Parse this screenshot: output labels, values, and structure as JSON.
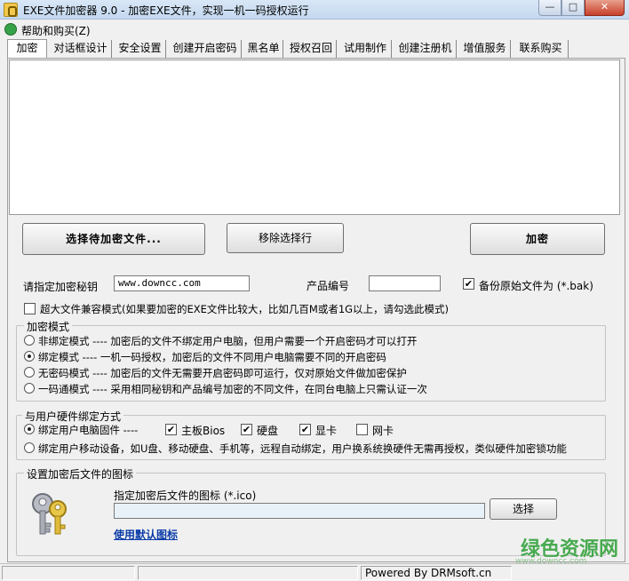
{
  "window": {
    "title": "EXE文件加密器 9.0 - 加密EXE文件，实现一机一码授权运行",
    "controls": {
      "minimize": "—",
      "maximize": "□",
      "close": "✕"
    }
  },
  "menu": {
    "help": "帮助和购买(Z)"
  },
  "tabs": [
    {
      "label": "加密"
    },
    {
      "label": "对话框设计"
    },
    {
      "label": "安全设置"
    },
    {
      "label": "创建开启密码"
    },
    {
      "label": "黑名单"
    },
    {
      "label": "授权召回"
    },
    {
      "label": "试用制作"
    },
    {
      "label": "创建注册机"
    },
    {
      "label": "增值服务"
    },
    {
      "label": "联系购买"
    }
  ],
  "actions": {
    "select_file": "选择待加密文件...",
    "remove_selected": "移除选择行",
    "encrypt": "加密"
  },
  "key_row": {
    "secret_label": "请指定加密秘钥",
    "secret_value": "www.downcc.com",
    "product_label": "产品编号",
    "product_value": "",
    "backup_label": "备份原始文件为 (*.bak)",
    "backup_checked": true
  },
  "large_file": {
    "label": "超大文件兼容模式(如果要加密的EXE文件比较大，比如几百M或者1G以上，请勾选此模式)",
    "checked": false
  },
  "encrypt_mode": {
    "title": "加密模式",
    "options": [
      {
        "label": "非绑定模式 ---- 加密后的文件不绑定用户电脑，但用户需要一个开启密码才可以打开",
        "selected": false
      },
      {
        "label": "绑定模式 ---- 一机一码授权，加密后的文件不同用户电脑需要不同的开启密码",
        "selected": true
      },
      {
        "label": "无密码模式 ---- 加密后的文件无需要开启密码即可运行，仅对原始文件做加密保护",
        "selected": false
      },
      {
        "label": "一码通模式 ---- 采用相同秘钥和产品编号加密的不同文件，在同台电脑上只需认证一次",
        "selected": false
      }
    ]
  },
  "hardware_bind": {
    "title": "与用户硬件绑定方式",
    "fixed_label": "绑定用户电脑固件 ----",
    "fixed_selected": true,
    "items": [
      {
        "label": "主板Bios",
        "checked": true
      },
      {
        "label": "硬盘",
        "checked": true
      },
      {
        "label": "显卡",
        "checked": true
      },
      {
        "label": "网卡",
        "checked": false
      }
    ],
    "mobile_label": "绑定用户移动设备，如U盘、移动硬盘、手机等，远程自动绑定，用户换系统换硬件无需再授权，类似硬件加密锁功能",
    "mobile_selected": false
  },
  "icon_group": {
    "title": "设置加密后文件的图标",
    "path_label": "指定加密后文件的图标 (*.ico)",
    "path_value": "",
    "choose_button": "选择",
    "default_link": "使用默认图标"
  },
  "status": {
    "powered": "Powered By DRMsoft.cn"
  },
  "watermark": {
    "main": "绿色资源网",
    "sub": "www.downcc.com"
  }
}
